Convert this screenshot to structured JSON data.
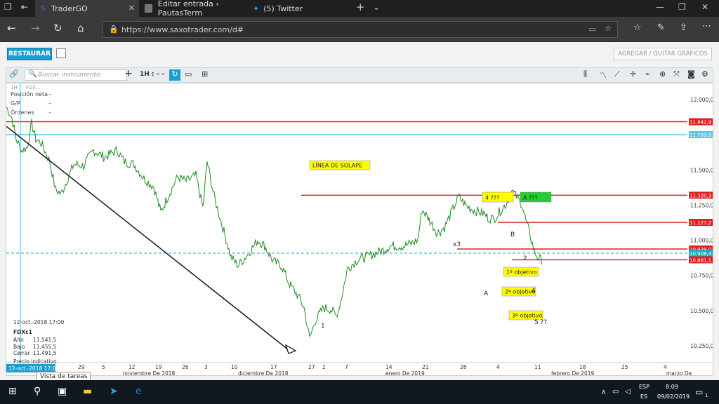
{
  "tabs": [
    {
      "label": "TraderGO",
      "active": true
    },
    {
      "label": "Editar entrada ‹ PautasTerm",
      "active": false
    },
    {
      "label": "(5) Twitter",
      "active": false
    }
  ],
  "address": {
    "url": "https://www.saxotrader.com/d#"
  },
  "app": {
    "restore_label": "RESTAURAR",
    "add_charts_label": "AGREGAR / QUITAR GRÁFICOS",
    "search_placeholder": "Buscar instrumento",
    "timeframe": "1H : – –"
  },
  "panel": {
    "chip1": "1H",
    "chip2": "FDX...",
    "rows": [
      {
        "label": "Posición neta",
        "value": "–"
      },
      {
        "label": "G/P",
        "value": "–"
      },
      {
        "label": "Órdenes",
        "value": "–"
      }
    ]
  },
  "ohlc": {
    "date": "12-oct.-2018 17:00",
    "symbol": "FDXc1",
    "rows": [
      {
        "k": "Alto",
        "v": "11.541,5"
      },
      {
        "k": "Bajo",
        "v": "11.455,5"
      },
      {
        "k": "Cerrar",
        "v": "11.491,5"
      }
    ],
    "indicative": "Precio indicativo",
    "cursor_date": "12-oct.-2018 17:00"
  },
  "tooltip": "Vista de tareas",
  "chart_data": {
    "type": "line",
    "y_ticks": [
      "12.000,0",
      "11.750,0",
      "11.500,0",
      "11.250,0",
      "11.000,0",
      "10.750,0",
      "10.500,0",
      "10.250,0"
    ],
    "y_values": [
      12000,
      11750,
      11500,
      11250,
      11000,
      10750,
      10500,
      10250
    ],
    "ylim": [
      10130,
      12115
    ],
    "x_ticks": [
      "29",
      "5",
      "12",
      "19",
      "26",
      "3",
      "10",
      "17",
      "27",
      "2",
      "7",
      "14",
      "21",
      "28",
      "4",
      "11",
      "18",
      "25",
      "4"
    ],
    "x_months": [
      "noviembre De 2018",
      "diciembre De 2018",
      "enero De 2019",
      "febrero De 2019",
      "marzo De"
    ],
    "levels": [
      {
        "label": "11.842,9",
        "value": 11842.9,
        "color": "#e02020",
        "style": "solid"
      },
      {
        "label": "11.750,9",
        "value": 11750.9,
        "color": "#5bc8e0",
        "style": "solid"
      },
      {
        "label": "11.320,3",
        "value": 11320.3,
        "color": "#e02020",
        "style": "solid"
      },
      {
        "label": "11.127,2",
        "value": 11127.2,
        "color": "#e02020",
        "style": "solid"
      },
      {
        "label": "10.938,0",
        "value": 10938.0,
        "color": "#e02020",
        "style": "solid"
      },
      {
        "label": "10.908,4",
        "value": 10908.4,
        "color": "#1ab0c8",
        "style": "dashed"
      },
      {
        "label": "10.861,1",
        "value": 10861.1,
        "color": "#e02020",
        "style": "solid"
      }
    ],
    "annotations": [
      {
        "text": "LÍNEA DE SOLAPE",
        "type": "box"
      },
      {
        "text": "4 ???",
        "type": "box"
      },
      {
        "text": "A ???",
        "type": "greenbox"
      },
      {
        "text": "1º objetivo",
        "type": "box"
      },
      {
        "text": "2º objetivo",
        "type": "box"
      },
      {
        "text": "3º objetivo",
        "type": "box"
      },
      {
        "text": "x3",
        "type": "box"
      },
      {
        "text": "x3",
        "type": "label"
      },
      {
        "text": "B",
        "type": "label"
      },
      {
        "text": "2",
        "type": "label"
      },
      {
        "text": "A",
        "type": "label"
      },
      {
        "text": "1",
        "type": "label"
      },
      {
        "text": "2",
        "type": "label"
      },
      {
        "text": "4",
        "type": "label"
      },
      {
        "text": "5 ??",
        "type": "label"
      }
    ],
    "colors": {
      "price": "#1f8a1f",
      "trend": "#222222",
      "resistance": "#e02020",
      "support": "#5bc8e0"
    }
  },
  "system": {
    "lang1": "ESP",
    "lang2": "ES",
    "time": "8:09",
    "date": "09/02/2019",
    "notif_count": "1"
  }
}
